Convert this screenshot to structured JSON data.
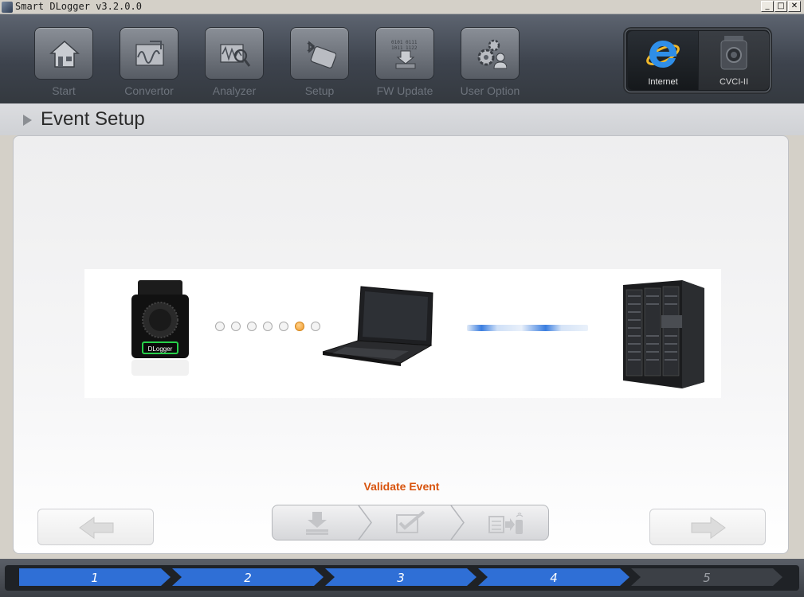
{
  "window": {
    "title": "Smart DLogger v3.2.0.0",
    "min_glyph": "_",
    "max_glyph": "□",
    "close_glyph": "✕"
  },
  "toolbar": {
    "items": [
      {
        "label": "Start",
        "icon": "home-icon"
      },
      {
        "label": "Convertor",
        "icon": "convertor-icon"
      },
      {
        "label": "Analyzer",
        "icon": "analyzer-icon"
      },
      {
        "label": "Setup",
        "icon": "bluetooth-device-icon"
      },
      {
        "label": "FW Update",
        "icon": "firmware-chip-icon"
      },
      {
        "label": "User Option",
        "icon": "gears-user-icon"
      }
    ],
    "connections": [
      {
        "label": "Internet",
        "icon": "internet-explorer-icon"
      },
      {
        "label": "CVCI-II",
        "icon": "cvci-device-icon"
      }
    ]
  },
  "page": {
    "title": "Event Setup"
  },
  "diagram": {
    "device_label": "DLogger",
    "dots_total": 7,
    "active_dot": 6
  },
  "status_text": "Validate Event",
  "wizard_steps": [
    {
      "icon": "download-icon"
    },
    {
      "icon": "edit-checklist-icon"
    },
    {
      "icon": "send-to-device-icon"
    }
  ],
  "progress": {
    "steps": [
      "1",
      "2",
      "3",
      "4",
      "5"
    ],
    "completed": 4
  },
  "colors": {
    "accent_orange": "#d8540e",
    "progress_blue": "#2f6fd6",
    "active_dot": "#ef9a2c"
  }
}
